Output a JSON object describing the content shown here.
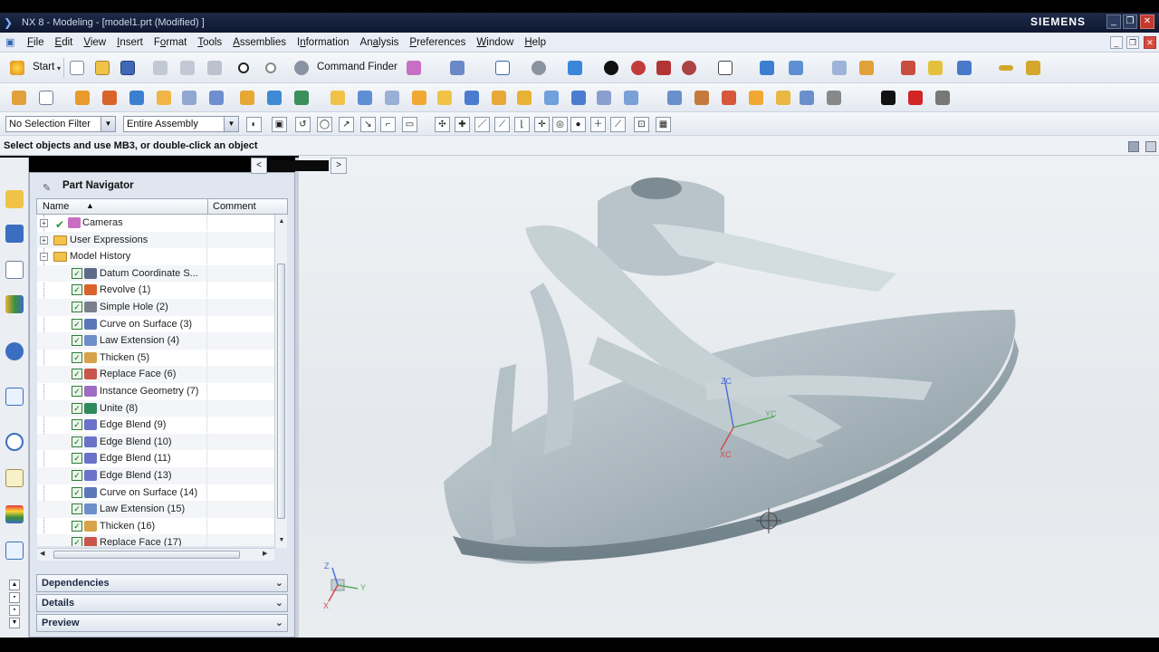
{
  "window": {
    "title": "NX 8 - Modeling - [model1.prt (Modified) ]",
    "brand": "SIEMENS",
    "controls": [
      "_",
      "❐",
      "✕"
    ]
  },
  "menu": {
    "items": [
      {
        "pre": "",
        "u": "F",
        "post": "ile"
      },
      {
        "pre": "",
        "u": "E",
        "post": "dit"
      },
      {
        "pre": "",
        "u": "V",
        "post": "iew"
      },
      {
        "pre": "",
        "u": "I",
        "post": "nsert"
      },
      {
        "pre": "F",
        "u": "o",
        "post": "rmat"
      },
      {
        "pre": "",
        "u": "T",
        "post": "ools"
      },
      {
        "pre": "",
        "u": "A",
        "post": "ssemblies"
      },
      {
        "pre": "I",
        "u": "n",
        "post": "formation"
      },
      {
        "pre": "An",
        "u": "a",
        "post": "lysis"
      },
      {
        "pre": "",
        "u": "P",
        "post": "references"
      },
      {
        "pre": "",
        "u": "W",
        "post": "indow"
      },
      {
        "pre": "",
        "u": "H",
        "post": "elp"
      }
    ]
  },
  "toolbar": {
    "start_label": "Start",
    "command_finder_label": "Command Finder"
  },
  "selection": {
    "filter_value": "No Selection Filter",
    "scope_value": "Entire Assembly"
  },
  "cue_line": "Select objects and use MB3, or double-click an object",
  "navigator": {
    "title": "Part Navigator",
    "columns": {
      "name": "Name",
      "comment": "Comment"
    },
    "groups": [
      {
        "label": "Cameras",
        "expander": "+"
      },
      {
        "label": "User Expressions",
        "expander": "+"
      },
      {
        "label": "Model History",
        "expander": "−"
      }
    ],
    "features": [
      {
        "label": "Datum Coordinate S...",
        "color": "#5d6b8a"
      },
      {
        "label": "Revolve (1)",
        "color": "#d9632b"
      },
      {
        "label": "Simple Hole (2)",
        "color": "#7a7f8c"
      },
      {
        "label": "Curve on Surface (3)",
        "color": "#5a78b8"
      },
      {
        "label": "Law Extension (4)",
        "color": "#6d8fc9"
      },
      {
        "label": "Thicken (5)",
        "color": "#d7a34a"
      },
      {
        "label": "Replace Face (6)",
        "color": "#c8564a"
      },
      {
        "label": "Instance Geometry (7)",
        "color": "#a06bc4"
      },
      {
        "label": "Unite (8)",
        "color": "#2f8a5b"
      },
      {
        "label": "Edge Blend (9)",
        "color": "#6a72c9"
      },
      {
        "label": "Edge Blend (10)",
        "color": "#6a72c9"
      },
      {
        "label": "Edge Blend (11)",
        "color": "#6a72c9"
      },
      {
        "label": "Edge Blend (13)",
        "color": "#6a72c9"
      },
      {
        "label": "Curve on Surface (14)",
        "color": "#5a78b8"
      },
      {
        "label": "Law Extension (15)",
        "color": "#6d8fc9"
      },
      {
        "label": "Thicken (16)",
        "color": "#d7a34a"
      },
      {
        "label": "Replace Face (17)",
        "color": "#c8564a"
      }
    ],
    "panels": [
      "Dependencies",
      "Details",
      "Preview"
    ]
  },
  "viewport": {
    "wcs_axes": {
      "z": "ZC",
      "y": "YC",
      "x": "XC"
    },
    "view_triad": {
      "z": "Z",
      "y": "Y",
      "x": "X"
    }
  },
  "colors": {
    "accent": "#3566b4",
    "model_surface": "#aab7be",
    "check": "#2e7d32"
  }
}
